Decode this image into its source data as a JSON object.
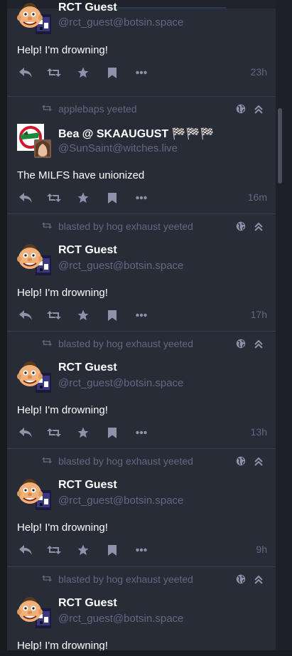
{
  "colors": {
    "column_bg": "#282c37",
    "page_bg": "#17191f",
    "muted_text": "#606984",
    "icon": "#8c93ab",
    "text": "#ffffff",
    "divider": "#393f4f"
  },
  "statuses": [
    {
      "prepend": null,
      "display_name": "RCT Guest",
      "acct": "@rct_guest@botsin.space",
      "content": "Help! I'm drowning!",
      "time": "23h",
      "avatar": "rct-guest-avatar"
    },
    {
      "prepend": "applebaps yeeted",
      "display_name": "Bea @ SKAAUGUST",
      "name_suffix": "🏁🏁🏁",
      "acct": "@SunSaint@witches.live",
      "content": "The MILFS have unionized",
      "time": "16m",
      "avatar": "bea-avatar"
    },
    {
      "prepend": "blasted by hog exhaust yeeted",
      "display_name": "RCT Guest",
      "acct": "@rct_guest@botsin.space",
      "content": "Help! I'm drowning!",
      "time": "17h",
      "avatar": "rct-guest-avatar"
    },
    {
      "prepend": "blasted by hog exhaust yeeted",
      "display_name": "RCT Guest",
      "acct": "@rct_guest@botsin.space",
      "content": "Help! I'm drowning!",
      "time": "13h",
      "avatar": "rct-guest-avatar"
    },
    {
      "prepend": "blasted by hog exhaust yeeted",
      "display_name": "RCT Guest",
      "acct": "@rct_guest@botsin.space",
      "content": "Help! I'm drowning!",
      "time": "9h",
      "avatar": "rct-guest-avatar"
    },
    {
      "prepend": "blasted by hog exhaust yeeted",
      "display_name": "RCT Guest",
      "acct": "@rct_guest@botsin.space",
      "content": "Help! I'm drowning!",
      "time": null,
      "avatar": "rct-guest-avatar"
    }
  ]
}
